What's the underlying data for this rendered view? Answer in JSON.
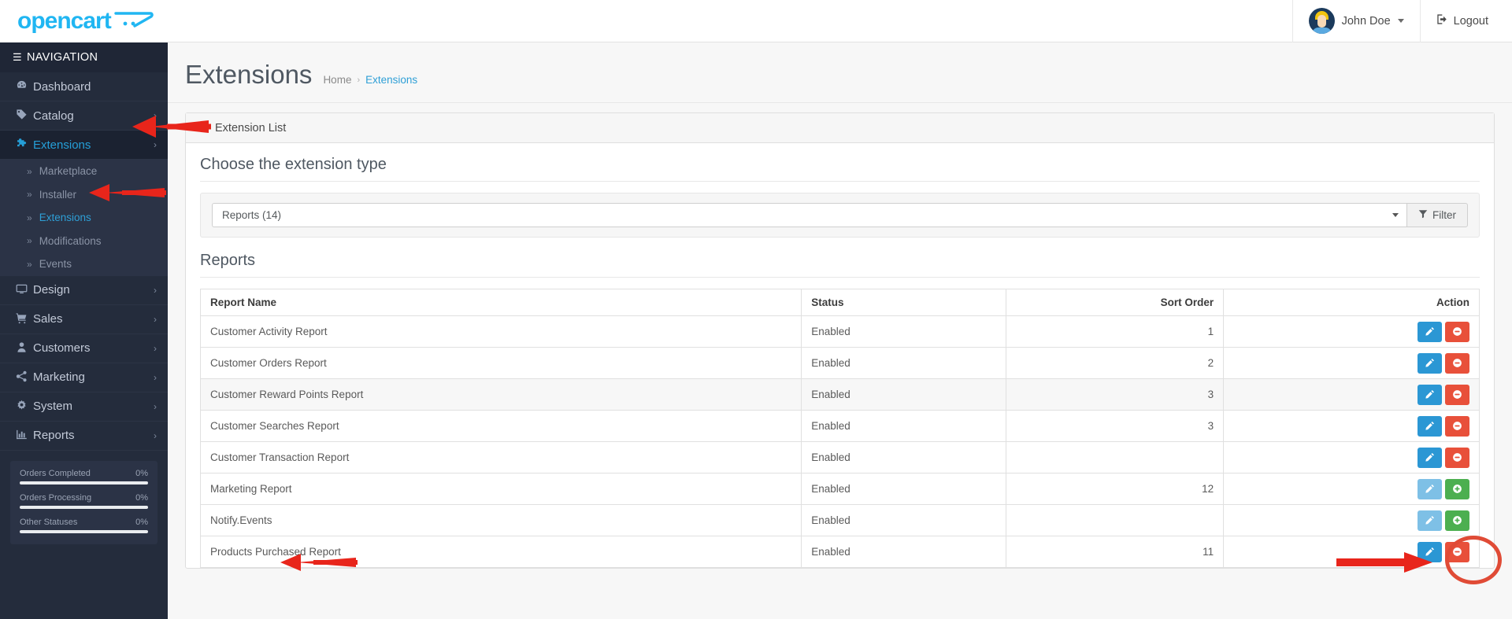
{
  "brand": {
    "name": "opencart",
    "accent": "#20b6f2"
  },
  "topbar": {
    "user_name": "John Doe",
    "logout_label": "Logout"
  },
  "sidebar": {
    "nav_title": "NAVIGATION",
    "items": [
      {
        "label": "Dashboard",
        "icon": "dashboard-icon",
        "chevron": false
      },
      {
        "label": "Catalog",
        "icon": "tag-icon",
        "chevron": true
      },
      {
        "label": "Extensions",
        "icon": "puzzle-icon",
        "chevron": true,
        "active": true
      },
      {
        "label": "Design",
        "icon": "monitor-icon",
        "chevron": true
      },
      {
        "label": "Sales",
        "icon": "cart-icon",
        "chevron": true
      },
      {
        "label": "Customers",
        "icon": "user-icon",
        "chevron": true
      },
      {
        "label": "Marketing",
        "icon": "share-icon",
        "chevron": true
      },
      {
        "label": "System",
        "icon": "gear-icon",
        "chevron": true
      },
      {
        "label": "Reports",
        "icon": "bar-chart-icon",
        "chevron": true
      }
    ],
    "sub_items": [
      {
        "label": "Marketplace"
      },
      {
        "label": "Installer"
      },
      {
        "label": "Extensions",
        "current": true
      },
      {
        "label": "Modifications"
      },
      {
        "label": "Events"
      }
    ],
    "stats": [
      {
        "label": "Orders Completed",
        "value": "0%",
        "percent": 0
      },
      {
        "label": "Orders Processing",
        "value": "0%",
        "percent": 0
      },
      {
        "label": "Other Statuses",
        "value": "0%",
        "percent": 0
      }
    ]
  },
  "page": {
    "title": "Extensions",
    "breadcrumb_home": "Home",
    "breadcrumb_sep": "›",
    "breadcrumb_current": "Extensions"
  },
  "panel": {
    "header": "Extension List",
    "header_icon": "puzzle-icon",
    "choose_heading": "Choose the extension type",
    "select_value": "Reports (14)",
    "filter_label": "Filter",
    "filter_icon": "funnel-icon",
    "section_heading": "Reports"
  },
  "table": {
    "columns": [
      "Report Name",
      "Status",
      "Sort Order",
      "Action"
    ],
    "rows": [
      {
        "name": "Customer Activity Report",
        "status": "Enabled",
        "sort": "1",
        "edit": "enabled",
        "action2": "remove"
      },
      {
        "name": "Customer Orders Report",
        "status": "Enabled",
        "sort": "2",
        "edit": "enabled",
        "action2": "remove"
      },
      {
        "name": "Customer Reward Points Report",
        "status": "Enabled",
        "sort": "3",
        "edit": "enabled",
        "action2": "remove",
        "striped": true
      },
      {
        "name": "Customer Searches Report",
        "status": "Enabled",
        "sort": "3",
        "edit": "enabled",
        "action2": "remove"
      },
      {
        "name": "Customer Transaction Report",
        "status": "Enabled",
        "sort": "",
        "edit": "enabled",
        "action2": "remove"
      },
      {
        "name": "Marketing Report",
        "status": "Enabled",
        "sort": "12",
        "edit": "disabled",
        "action2": "install"
      },
      {
        "name": "Notify.Events",
        "status": "Enabled",
        "sort": "",
        "edit": "disabled",
        "action2": "install",
        "highlighted": true
      },
      {
        "name": "Products Purchased Report",
        "status": "Enabled",
        "sort": "11",
        "edit": "enabled",
        "action2": "remove"
      }
    ]
  },
  "annotations": {
    "arrow_color": "#e8251b",
    "ellipse_color": "#e04b36",
    "arrows": [
      {
        "name": "arrow-to-extensions-nav"
      },
      {
        "name": "arrow-to-extensions-subnav"
      },
      {
        "name": "arrow-to-notify-events-row"
      },
      {
        "name": "arrow-to-install-button"
      }
    ]
  }
}
